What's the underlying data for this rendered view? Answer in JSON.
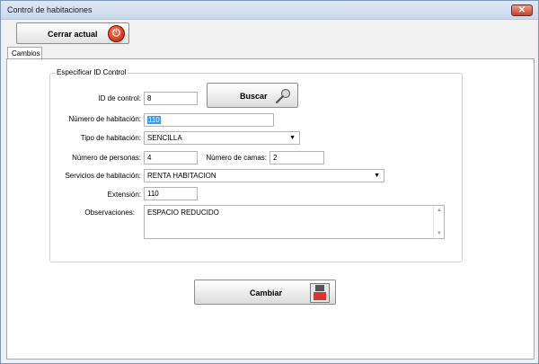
{
  "window": {
    "title": "Control de habitaciones",
    "close_glyph": "✕"
  },
  "toolbar": {
    "close_current_label": "Cerrar actual",
    "close_icon": "power-icon"
  },
  "tabs": [
    {
      "label": "Cambios"
    }
  ],
  "group": {
    "legend": "Especificar ID Control"
  },
  "form": {
    "id_control_label": "ID de control:",
    "id_control_value": "8",
    "search_label": "Buscar",
    "room_number_label": "Número de habitación:",
    "room_number_value": "110",
    "room_type_label": "Tipo de habitación:",
    "room_type_value": "SENCILLA",
    "people_label": "Número de personas:",
    "people_value": "4",
    "beds_label": "Número de camas:",
    "beds_value": "2",
    "services_label": "Servicios de habitación:",
    "services_value": "RENTA HABITACION",
    "extension_label": "Extensión:",
    "extension_value": "110",
    "notes_label": "Observaciones:",
    "notes_value": "ESPACIO REDUCIDO"
  },
  "actions": {
    "change_label": "Cambiar"
  }
}
